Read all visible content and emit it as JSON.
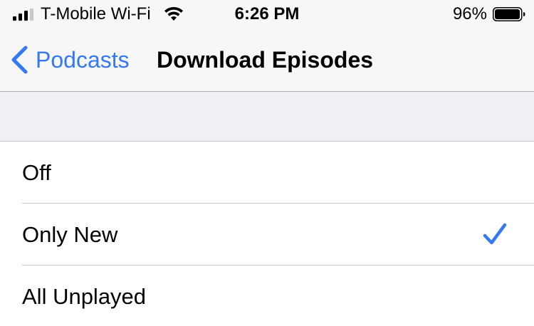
{
  "status_bar": {
    "carrier": "T-Mobile Wi-Fi",
    "time": "6:26 PM",
    "battery_percent": "96%",
    "signal_bars_filled": 3,
    "signal_bars_total": 4,
    "battery_level": 0.96
  },
  "nav": {
    "back_label": "Podcasts",
    "title": "Download Episodes"
  },
  "options": [
    {
      "label": "Off",
      "selected": false
    },
    {
      "label": "Only New",
      "selected": true
    },
    {
      "label": "All Unplayed",
      "selected": false
    }
  ],
  "colors": {
    "accent": "#3478f6",
    "chrome_bg": "#f7f7f7",
    "group_bg": "#efeff4",
    "separator": "#c8c7cc"
  },
  "icons": {
    "signal": "cellular-signal-icon",
    "wifi": "wifi-icon",
    "battery": "battery-icon",
    "back": "chevron-left-icon",
    "selected": "checkmark-icon"
  }
}
